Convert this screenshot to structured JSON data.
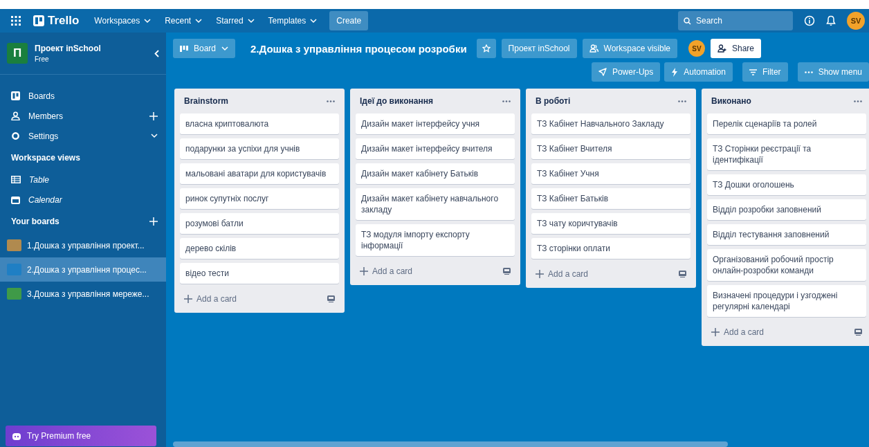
{
  "header": {
    "brand": "Trello",
    "nav": [
      "Workspaces",
      "Recent",
      "Starred",
      "Templates"
    ],
    "create": "Create",
    "search": {
      "placeholder": "Search"
    },
    "avatar": "SV"
  },
  "sidebar": {
    "workspace": {
      "badge": "П",
      "name": "Проект inSchool",
      "plan": "Free"
    },
    "items": [
      {
        "label": "Boards",
        "kind": "boards"
      },
      {
        "label": "Members",
        "kind": "members"
      },
      {
        "label": "Settings",
        "kind": "settings"
      }
    ],
    "views_heading": "Workspace views",
    "views": [
      {
        "label": "Table",
        "kind": "table"
      },
      {
        "label": "Calendar",
        "kind": "calendar"
      }
    ],
    "boards_heading": "Your boards",
    "boards": [
      {
        "label": "1.Дошка з управління проект...",
        "color": "#b08a4f",
        "selected": false
      },
      {
        "label": "2.Дошка з управління процес...",
        "color": "#1f7fc4",
        "selected": true
      },
      {
        "label": "3.Дошка з управління мереже...",
        "color": "#3f9a48",
        "selected": false
      }
    ],
    "premium": "Try Premium free"
  },
  "board": {
    "view": "Board",
    "title": "2.Дошка з управління процесом розробки",
    "workspace": "Проект inSchool",
    "visibility": "Workspace visible",
    "member": "SV",
    "share": "Share",
    "actions": [
      {
        "label": "Power-Ups",
        "kind": "powerups"
      },
      {
        "label": "Automation",
        "kind": "automation"
      },
      {
        "label": "Filter",
        "kind": "filter"
      },
      {
        "label": "Show menu",
        "kind": "menu"
      }
    ],
    "lists": [
      {
        "title": "Brainstorm",
        "cards": [
          "власна криптовалюта",
          "подарунки за успіхи для учнів",
          "мальовані аватари для користувачів",
          "ринок супутніх послуг",
          "розумові батли",
          "дерево скілів",
          "відео тести"
        ],
        "add": "Add a card"
      },
      {
        "title": "Ідеї до виконання",
        "cards": [
          "Дизайн макет інтерфейсу учня",
          "Дизайн макет інтерфейсу вчителя",
          "Дизайн макет кабінету Батьків",
          "Дизайн макет кабінету навчального закладу",
          "ТЗ модуля імпорту експорту інформації"
        ],
        "add": "Add a card"
      },
      {
        "title": "В роботі",
        "cards": [
          "ТЗ Кабінет Навчального Закладу",
          "ТЗ Кабінет Вчителя",
          "ТЗ Кабінет Учня",
          "ТЗ Кабінет Батьків",
          "ТЗ чату коричтувачів",
          "ТЗ сторінки оплати"
        ],
        "add": "Add a card"
      },
      {
        "title": "Виконано",
        "cards": [
          "Перелік сценаріїв та ролей",
          "ТЗ Сторінки реєстрації та ідентифікації",
          "ТЗ Дошки оголошень",
          "Відділ розробки заповнений",
          "Відділ тестування заповнений",
          "Організований робочий простір онлайн-розробки команди",
          "Визначені процедури і узгоджені регулярні календарі"
        ],
        "add": "Add a card"
      }
    ]
  }
}
